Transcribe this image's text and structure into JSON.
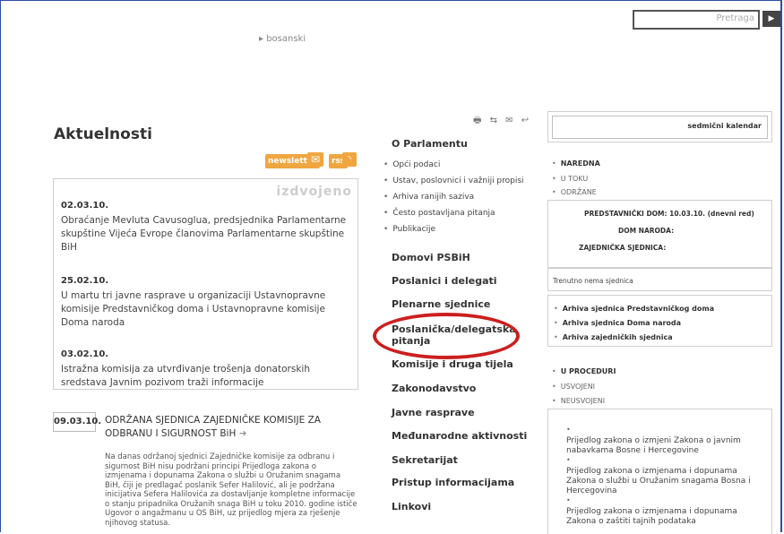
{
  "search": {
    "placeholder": "Pretraga",
    "button": "▶"
  },
  "language": "▸ bosanski",
  "left": {
    "title": "Aktuelnosti",
    "badges": [
      "newsletter",
      "rss"
    ],
    "izdvojeno": "izdvojeno",
    "news": [
      {
        "date": "02.03.10.",
        "text": "Obraćanje Mevluta Cavusoglua, predsjednika Parlamentarne skupštine Vijeća Evrope članovima Parlamentarne skupštine BiH"
      },
      {
        "date": "25.02.10.",
        "text": "U martu tri javne rasprave u organizaciji Ustavnopravne komisije Predstavničkog doma i Ustavnopravne komisije Doma naroda"
      },
      {
        "date": "03.02.10.",
        "text": "Istražna komisija za utvrđivanje trošenja donatorskih sredstava Javnim pozivom traži informacije"
      }
    ],
    "featured": {
      "date": "09.03.10.",
      "headline": "ODRŽANA SJEDNICA ZAJEDNIČKE KOMISIJE ZA ODBRANU I SIGURNOST BiH",
      "arrow": "➜",
      "body": "Na danas održanoj sjednici Zajedničke komisije za odbranu i sigurnost BiH nisu podržani principi Prijedloga zakona o izmjenama i dopunama Zakona o službi u Oružanim snagama BiH, čiji je predlagač poslanik Sefer Halilović, ali je podržana inicijativa Sefera Halilovića za dostavljanje kompletne informacije o stanju pripadnika Oružanih snaga BiH u toku 2010. godine ističe Ugovor o angažmanu u OS BiH, uz prijedlog mjera za rješenje njihovog statusa."
    }
  },
  "middle": {
    "tools": "🖶 ⇆ ✉ ↩",
    "section_title": "O Parlamentu",
    "sub_links": [
      "Opći podaci",
      "Ustav, poslovnici i važniji propisi",
      "Arhiva ranijih saziva",
      "Često postavljana pitanja",
      "Publikacije"
    ],
    "main_links": [
      "Domovi PSBiH",
      "Poslanici i delegati",
      "Plenarne sjednice",
      "Poslanička/delegatska pitanja",
      "Komisije i druga tijela",
      "Zakonodavstvo",
      "Javne rasprave",
      "Međunarodne aktivnosti",
      "Sekretarijat",
      "Pristup informacijama",
      "Linkovi"
    ]
  },
  "right": {
    "calendar": "sedmični kalendar",
    "session_nav": [
      "NAREDNA",
      "U TOKU",
      "ODRŽANE"
    ],
    "sessions": [
      "PREDSTAVNIČKI DOM: 10.03.10. (dnevni red)",
      "DOM NARODA:",
      "ZAJEDNIČKA SJEDNICA:"
    ],
    "no_session": "Trenutno nema sjednica",
    "archives": [
      "Arhiva sjednica Predstavničkog doma",
      "Arhiva sjednica Doma naroda",
      "Arhiva zajedničkih sjednica"
    ],
    "law_nav": [
      "U PROCEDURI",
      "USVOJENI",
      "NEUSVOJENI"
    ],
    "laws": [
      "Prijedlog zakona o izmjeni Zakona o javnim nabavkama Bosne i Hercegovine",
      "Prijedlog zakona o izmjenama i dopunama Zakona o službi u Oružanim snagama Bosna i Hercegovina",
      "Prijedlog zakona o izmjenama i dopunama Zakona o zaštiti tajnih podataka"
    ]
  }
}
